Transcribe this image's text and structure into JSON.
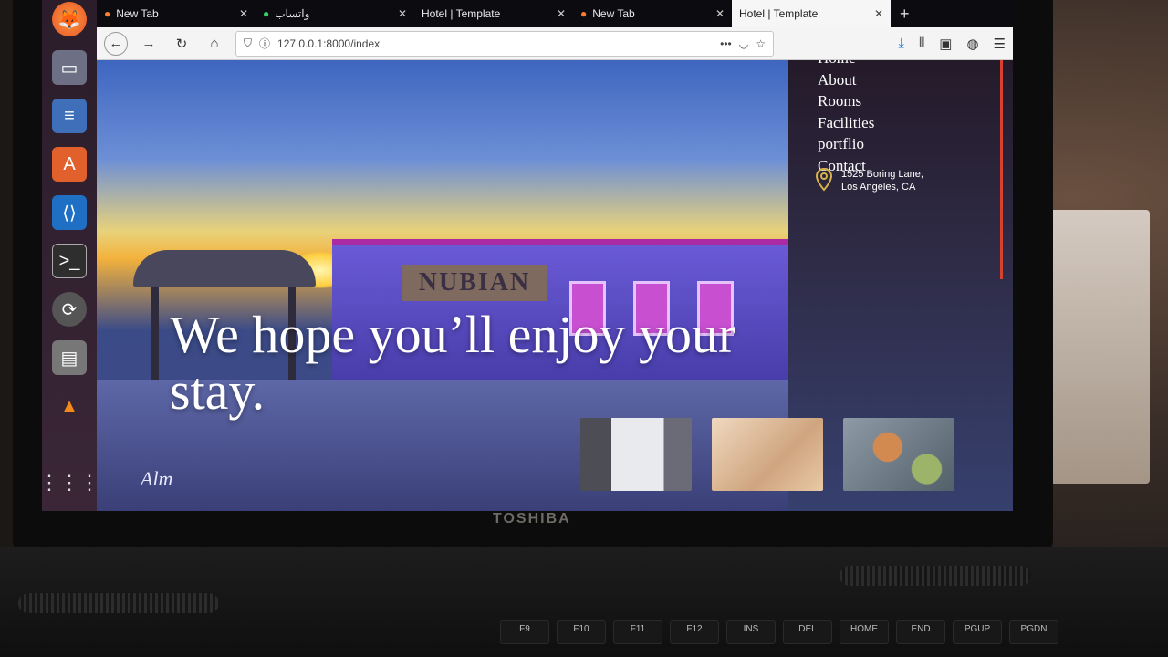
{
  "browser": {
    "tabs": [
      {
        "title": "New Tab",
        "icon": "firefox-icon"
      },
      {
        "title": "واتساب",
        "icon": "whatsapp-icon"
      },
      {
        "title": "Hotel | Template",
        "icon": ""
      },
      {
        "title": "New Tab",
        "icon": "firefox-icon"
      },
      {
        "title": "Hotel | Template",
        "icon": "",
        "active": true
      }
    ],
    "new_tab_symbol": "+",
    "url": "127.0.0.1:8000/index"
  },
  "dock": {
    "apps": [
      "firefox-icon",
      "files-icon",
      "writer-icon",
      "software-center-icon",
      "vscode-icon",
      "terminal-icon",
      "software-updater-icon",
      "scanner-icon",
      "vlc-icon"
    ],
    "show_apps_icon": "grid-icon"
  },
  "site": {
    "menu": [
      "Home",
      "About",
      "Rooms",
      "Facilities",
      "portflio",
      "Contact"
    ],
    "address_line1": "1525 Boring Lane,",
    "address_line2": "Los Angeles, CA",
    "hero_headline": "We hope you’ll enjoy your stay.",
    "hero_sign": "NUBIAN",
    "watermark": "Alm",
    "accent_color": "#d9412f"
  },
  "device": {
    "brand": "TOSHIBA",
    "keys": [
      "F9",
      "F10",
      "F11",
      "F12",
      "INS",
      "DEL",
      "HOME",
      "END",
      "PGUP",
      "PGDN"
    ]
  }
}
